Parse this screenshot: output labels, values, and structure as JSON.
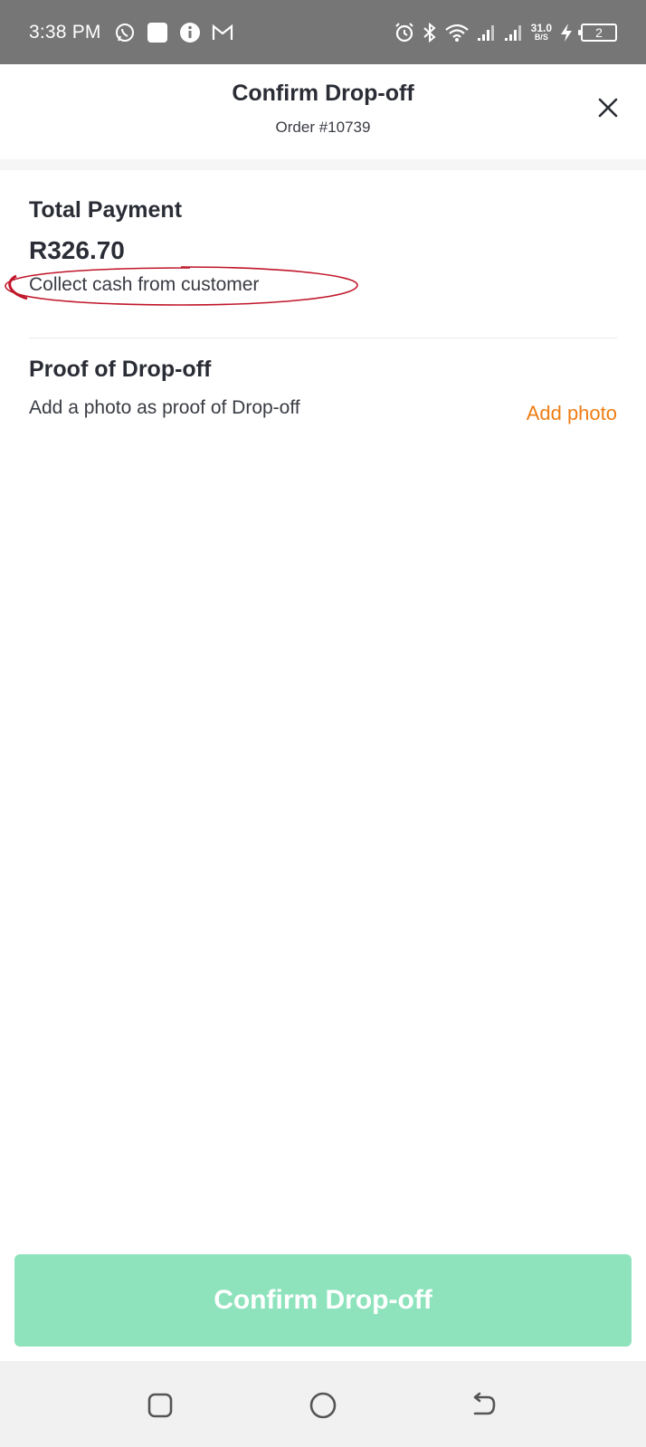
{
  "status_bar": {
    "time": "3:38 PM",
    "network_speed_value": "31.0",
    "network_speed_unit": "B/S",
    "battery_level": "2",
    "left_icons": [
      "whatsapp-icon",
      "square-notification-icon",
      "info-icon",
      "gmail-icon"
    ],
    "right_icons": [
      "alarm-icon",
      "bluetooth-icon",
      "wifi-icon",
      "signal-icon",
      "signal-icon",
      "charging-icon",
      "battery-icon"
    ]
  },
  "header": {
    "title": "Confirm Drop-off",
    "subtitle": "Order #10739",
    "close_icon": "close-icon"
  },
  "payment": {
    "title": "Total Payment",
    "amount": "R326.70",
    "instruction": "Collect cash from customer",
    "annotation_color": "#c0162a"
  },
  "proof": {
    "title": "Proof of Drop-off",
    "description": "Add a photo as proof of Drop-off",
    "action_label": "Add photo",
    "action_color": "#ef7d14"
  },
  "footer": {
    "confirm_label": "Confirm Drop-off",
    "confirm_color": "#8ee3bd"
  },
  "nav_bar": {
    "buttons": [
      "recents-square-icon",
      "home-circle-icon",
      "back-arrow-icon"
    ]
  }
}
